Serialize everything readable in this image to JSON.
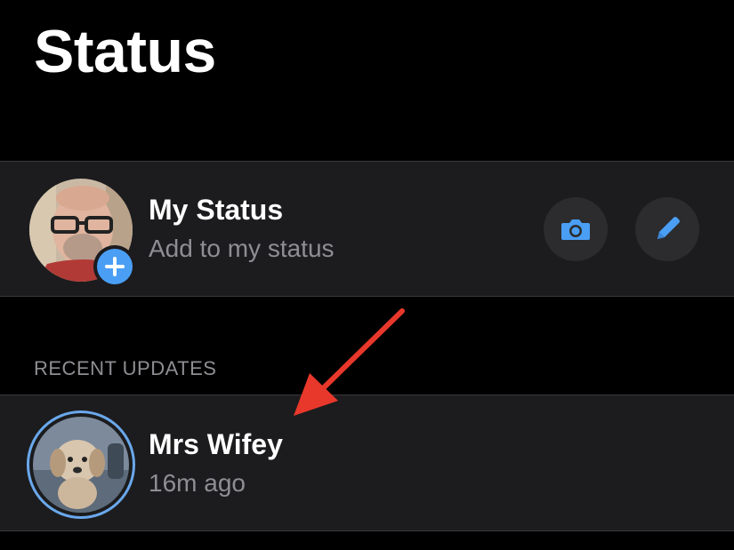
{
  "header": {
    "title": "Status"
  },
  "my_status": {
    "title": "My Status",
    "subtitle": "Add to my status",
    "avatar_icon": "profile-photo",
    "badge_icon": "plus-icon",
    "actions": [
      {
        "icon": "camera-icon"
      },
      {
        "icon": "pencil-icon"
      }
    ]
  },
  "recent": {
    "section_label": "RECENT UPDATES",
    "items": [
      {
        "name": "Mrs Wifey",
        "time": "16m ago",
        "avatar_icon": "dog-photo"
      }
    ]
  },
  "colors": {
    "background": "#000000",
    "row_background": "#1c1c1e",
    "accent": "#4a9ff5",
    "ring": "#6aa8ec",
    "secondary_text": "#8e8e93",
    "annotation_arrow": "#e8382b"
  }
}
